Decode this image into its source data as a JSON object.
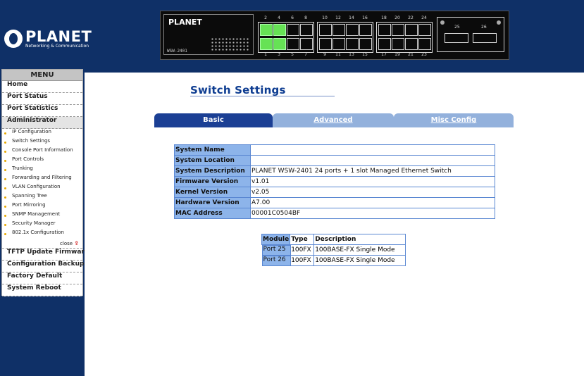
{
  "brand": {
    "logo_text": "PLANET",
    "tagline": "Networking & Communication"
  },
  "device_panel": {
    "brand": "PLANET",
    "model": "WSW-2401",
    "top_port_numbers": [
      "2",
      "4",
      "6",
      "8",
      "10",
      "12",
      "14",
      "16",
      "18",
      "20",
      "22",
      "24"
    ],
    "bottom_port_numbers": [
      "1",
      "3",
      "5",
      "7",
      "9",
      "11",
      "13",
      "15",
      "17",
      "19",
      "21",
      "23"
    ],
    "active_ports": [
      "1",
      "2",
      "3",
      "4"
    ],
    "sfp_ports": [
      "25",
      "26"
    ],
    "active_color": "#66e255"
  },
  "menu": {
    "title": "MENU",
    "items_top": [
      "Home",
      "Port Status",
      "Port Statistics",
      "Administrator"
    ],
    "sub_items": [
      "IP Configuration",
      "Switch Settings",
      "Console Port Information",
      "Port Controls",
      "Trunking",
      "Forwarding and Filtering",
      "VLAN Configuration",
      "Spanning Tree",
      "Port Mirroring",
      "SNMP Management",
      "Security Manager",
      "802.1x Configuration"
    ],
    "close_label": "close",
    "items_bottom": [
      "TFTP Update Firmware",
      "Configuration Backup",
      "Factory Default",
      "System Reboot"
    ]
  },
  "page": {
    "title": "Switch Settings",
    "tabs": [
      "Basic",
      "Advanced",
      "Misc Config"
    ],
    "active_tab": "Basic"
  },
  "system_info": [
    {
      "label": "System Name",
      "value": ""
    },
    {
      "label": "System Location",
      "value": ""
    },
    {
      "label": "System Description",
      "value": "PLANET WSW-2401 24 ports + 1 slot Managed Ethernet Switch"
    },
    {
      "label": "Firmware Version",
      "value": "v1.01"
    },
    {
      "label": "Kernel Version",
      "value": "v2.05"
    },
    {
      "label": "Hardware Version",
      "value": "A7.00"
    },
    {
      "label": "MAC Address",
      "value": "00001C0504BF"
    }
  ],
  "module_table": {
    "headers": [
      "Module",
      "Type",
      "Description"
    ],
    "rows": [
      {
        "module": "Port 25",
        "type": "100FX",
        "description": "100BASE-FX Single Mode"
      },
      {
        "module": "Port 26",
        "type": "100FX",
        "description": "100BASE-FX Single Mode"
      }
    ]
  },
  "colors": {
    "frame": "#0f3067",
    "tab_active": "#1b3f94",
    "tab_inactive": "#93b1dc",
    "label_cell": "#8db4ea",
    "title": "#0d3c91"
  }
}
